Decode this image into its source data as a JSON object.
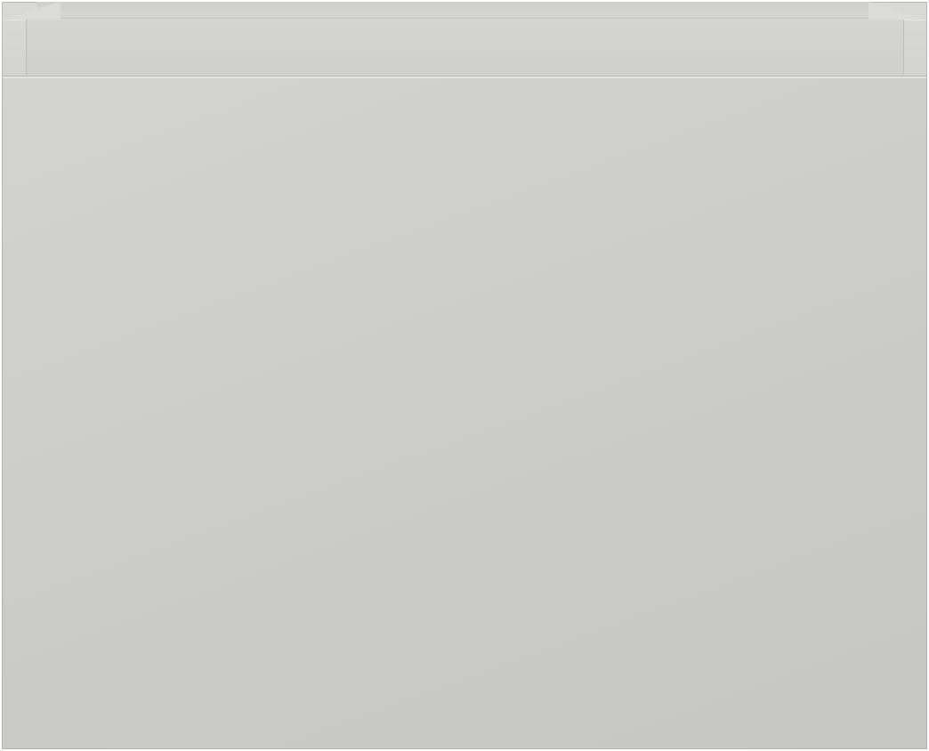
{
  "scene": {
    "object": "drawer-box",
    "colors": {
      "panel": "#cdcdcb",
      "rim": "#d6d6d4",
      "edge": "#b3b3b1",
      "background": "#ffffff"
    }
  }
}
